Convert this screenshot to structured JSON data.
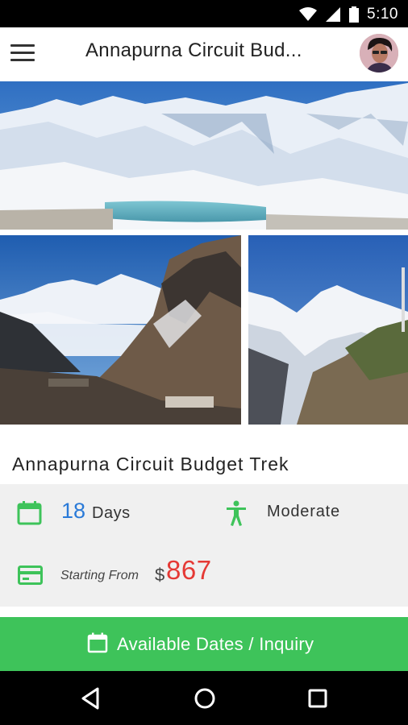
{
  "status_bar": {
    "time": "5:10",
    "icons": [
      "wifi-icon",
      "signal-icon",
      "battery-icon"
    ]
  },
  "app_bar": {
    "title": "Annapurna Circuit Bud...",
    "menu_icon": "hamburger-menu-icon",
    "avatar": "user-avatar"
  },
  "gallery": {
    "images": [
      "mountain-lake-photo",
      "mountain-valley-photo",
      "snowy-peak-photo"
    ]
  },
  "trek": {
    "title": "Annapurna Circuit Budget Trek",
    "duration_value": "18",
    "duration_unit": "Days",
    "difficulty": "Moderate",
    "starting_label": "Starting From",
    "currency": "$",
    "price": "867"
  },
  "cta": {
    "label": "Available Dates / Inquiry",
    "icon": "calendar-icon"
  },
  "colors": {
    "accent_green": "#3ec35a",
    "price_red": "#e53935",
    "duration_blue": "#2a7ad8",
    "panel_gray": "#f0f0f0"
  },
  "nav": {
    "buttons": [
      "back-icon",
      "home-icon",
      "recents-icon"
    ]
  }
}
